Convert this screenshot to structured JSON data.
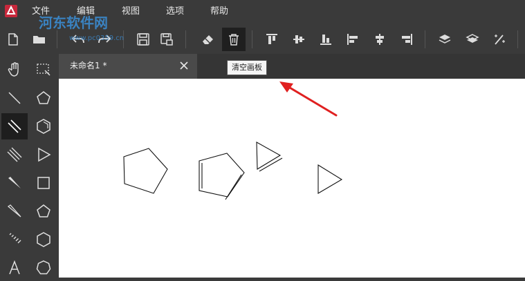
{
  "menu": {
    "items": [
      {
        "label": "文件"
      },
      {
        "label": "编辑"
      },
      {
        "label": "视图"
      },
      {
        "label": "选项"
      },
      {
        "label": "帮助"
      }
    ]
  },
  "watermark": {
    "text": "河东软件网",
    "url": "www.pc0359.cn"
  },
  "toolbar": {
    "items": [
      "new-file-icon",
      "open-folder-icon",
      "undo-icon",
      "redo-icon",
      "save-icon",
      "save-as-icon",
      "eraser-icon",
      "clear-canvas-icon",
      "align-top-icon",
      "align-middle-icon",
      "align-bottom-icon",
      "align-left-icon",
      "align-center-icon",
      "align-right-icon",
      "bring-to-front-icon",
      "send-to-back-icon",
      "magic-wand-icon"
    ],
    "active": "clear-canvas-icon"
  },
  "tooltip": {
    "text": "清空画板"
  },
  "document": {
    "tab_title": "未命名1 *"
  },
  "colors": {
    "chrome": "#3a3a3a",
    "active": "#1e1e1e",
    "canvas": "#ffffff",
    "annotation_arrow": "#e02020"
  }
}
